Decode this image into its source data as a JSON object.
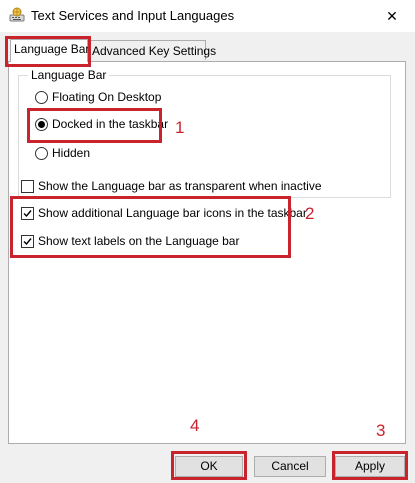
{
  "window": {
    "title": "Text Services and Input Languages",
    "icon": "keyboard-globe-icon",
    "close_glyph": "✕"
  },
  "tabs": [
    {
      "label": "Language Bar",
      "selected": true
    },
    {
      "label": "Advanced Key Settings",
      "selected": false
    }
  ],
  "language_bar_group": {
    "label": "Language Bar",
    "options": [
      {
        "label": "Floating On Desktop",
        "selected": false
      },
      {
        "label": "Docked in the taskbar",
        "selected": true
      },
      {
        "label": "Hidden",
        "selected": false
      }
    ]
  },
  "checkboxes": [
    {
      "label": "Show the Language bar as transparent when inactive",
      "checked": false
    },
    {
      "label": "Show additional Language bar icons in the taskbar",
      "checked": true
    },
    {
      "label": "Show text labels on the Language bar",
      "checked": true
    }
  ],
  "buttons": {
    "ok": "OK",
    "cancel": "Cancel",
    "apply": "Apply"
  },
  "annotations": {
    "color": "#c9232e",
    "markers": [
      "1",
      "2",
      "3",
      "4"
    ]
  }
}
